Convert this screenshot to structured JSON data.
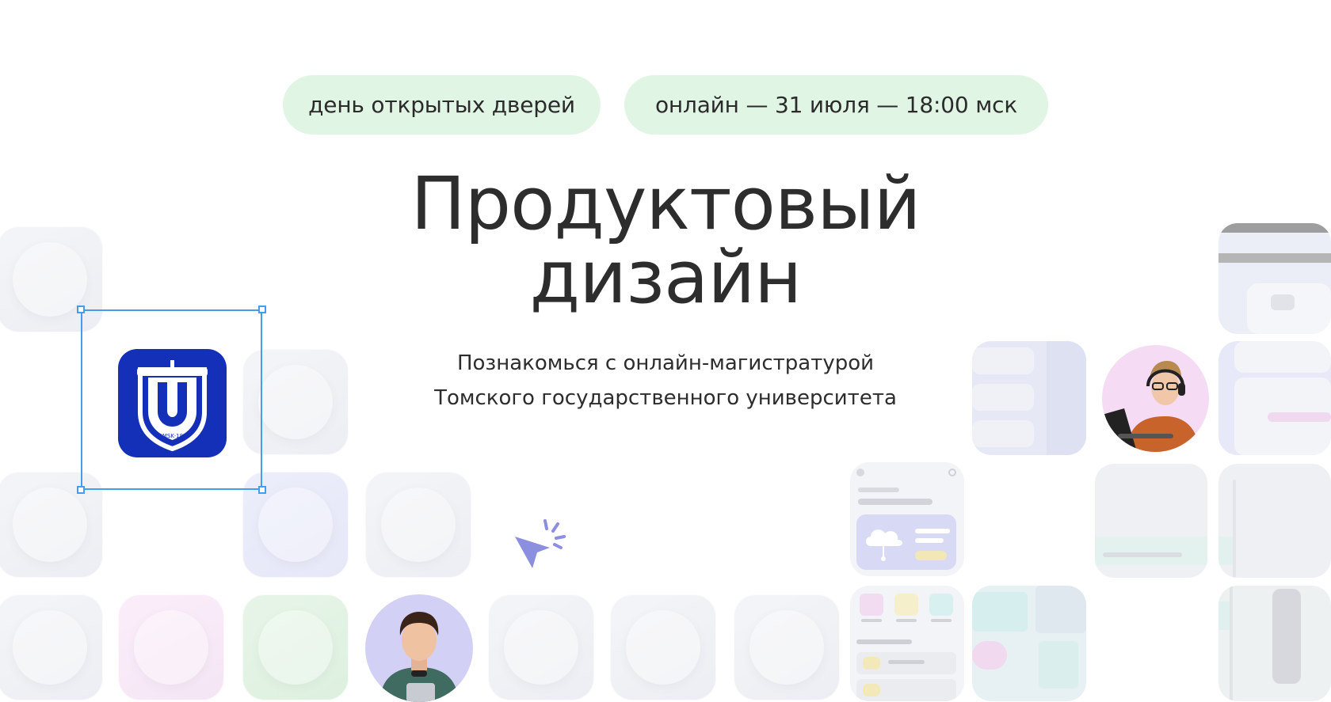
{
  "badges": {
    "event": "день открытых дверей",
    "schedule": "онлайн — 31 июля — 18:00 мск"
  },
  "headline": {
    "line1": "Продуктовый",
    "line2": "дизайн"
  },
  "subtitle": {
    "line1": "Познакомься с онлайн-магистратурой",
    "line2": "Томского государственного университета"
  },
  "logo": {
    "seal_text": "TOMSK·1878"
  },
  "colors": {
    "pill_bg": "#e1f5e5",
    "brand_blue": "#1530b8",
    "selection": "#4a9be8",
    "cursor": "#8c8fdf"
  },
  "icons": [
    "university-logo-icon",
    "cursor-click-icon",
    "cloud-icon"
  ]
}
